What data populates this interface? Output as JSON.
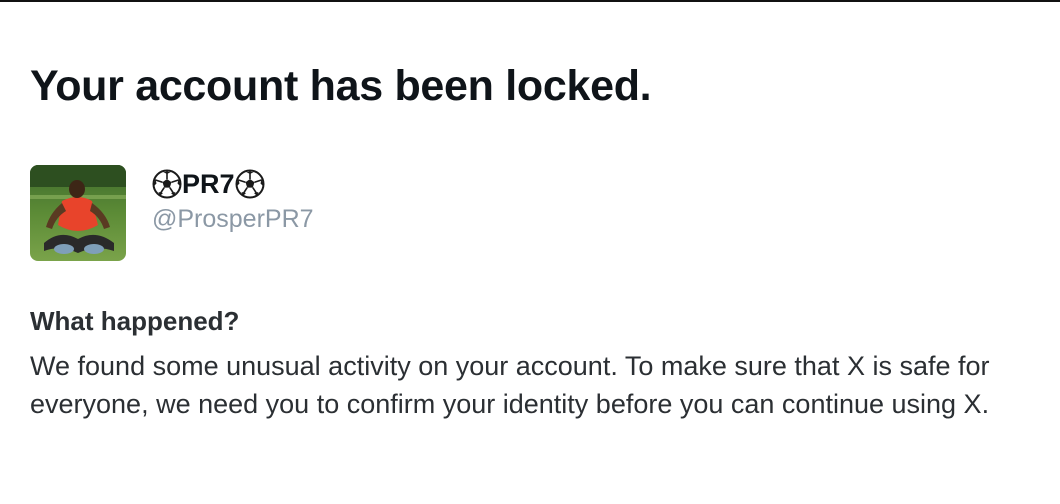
{
  "page": {
    "title": "Your account has been locked."
  },
  "profile": {
    "avatar_alt": "ProsperPR7 profile photo",
    "display_name": "PR7",
    "display_name_icon": "soccer-ball-icon",
    "handle": "@ProsperPR7"
  },
  "info": {
    "heading": "What happened?",
    "body": "We found some unusual activity on your account. To make sure that X is safe for everyone, we need you to confirm your identity before you can continue using X."
  },
  "colors": {
    "text_primary": "#0f1419",
    "text_secondary": "#8b98a5",
    "body_text": "#2b2f33",
    "background": "#ffffff"
  }
}
